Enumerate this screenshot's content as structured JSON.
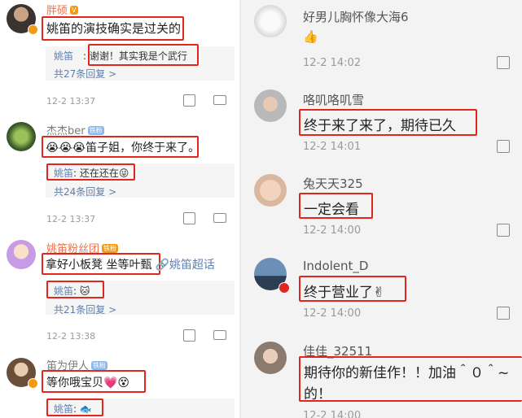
{
  "left": {
    "comments": [
      {
        "name": "胖硕",
        "text": "姚笛的演技确实是过关的",
        "reply": {
          "name": "姚笛",
          "text": ": 谢谢！其实我是个武行"
        },
        "more": "共27条回复 >",
        "time": "12-2 13:37"
      },
      {
        "name": "杰杰ber",
        "badge": "铁粉",
        "text": "😭😭😭笛子姐，你终于来了。",
        "reply": {
          "name": "姚笛",
          "text": ": 还在还在😜"
        },
        "more": "共24条回复 >",
        "time": "12-2 13:37"
      },
      {
        "name": "姚笛粉丝团",
        "badge": "铁粉",
        "text": "拿好小板凳 坐等叶甄",
        "text_extra": "姚笛超话",
        "reply": {
          "name": "姚笛",
          "text": ": 🐱"
        },
        "more": "共21条回复 >",
        "time": "12-2 13:38"
      },
      {
        "name": "笛为伊人",
        "badge": "铁粉",
        "text": "等你哦宝贝💗😵",
        "reply": {
          "name": "姚笛",
          "text": ": 🐟"
        }
      }
    ]
  },
  "right": {
    "comments": [
      {
        "name": "好男儿胸怀像大海6",
        "text": "👍",
        "time": "12-2 14:02"
      },
      {
        "name": "咯叽咯叽雪",
        "text": "终于来了来了，期待已久",
        "time": "12-2 14:01"
      },
      {
        "name": "兔天天325",
        "text": "一定会看",
        "time": "12-2 14:00"
      },
      {
        "name": "Indolent_D",
        "text": "终于营业了✌",
        "time": "12-2 14:00"
      },
      {
        "name": "佳佳_32511",
        "text": "期待你的新佳作！！加油＾０＾~",
        "text2": "的！",
        "time": "12-2 14:00"
      }
    ]
  },
  "colors": {
    "highlight": "#e0261d",
    "link": "#5e7fac",
    "username_orange": "#eb7350",
    "badge": "#8fb7e8"
  }
}
